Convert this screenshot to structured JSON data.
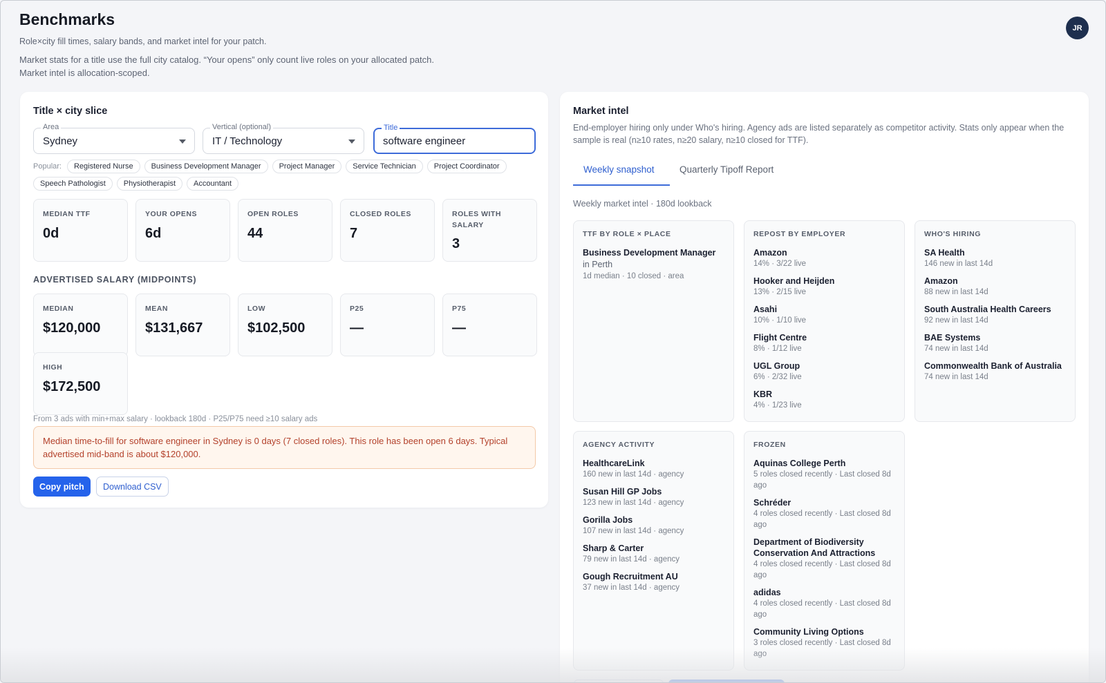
{
  "header": {
    "title": "Benchmarks",
    "subtitle": "Role×city fill times, salary bands, and market intel for your patch.",
    "description": "Market stats for a title use the full city catalog. “Your opens” only count live roles on your allocated patch. Market intel is allocation-scoped.",
    "avatar_initials": "JR"
  },
  "slice": {
    "title": "Title × city slice",
    "area": {
      "label": "Area",
      "value": "Sydney"
    },
    "vertical": {
      "label": "Vertical (optional)",
      "value": "IT / Technology"
    },
    "title_field": {
      "label": "Title",
      "value": "software engineer"
    },
    "popular_label": "Popular:",
    "popular": [
      "Registered Nurse",
      "Business Development Manager",
      "Project Manager",
      "Service Technician",
      "Project Coordinator",
      "Speech Pathologist",
      "Physiotherapist",
      "Accountant"
    ],
    "stats": [
      {
        "label": "MEDIAN TTF",
        "value": "0d"
      },
      {
        "label": "YOUR OPENS",
        "value": "6d"
      },
      {
        "label": "OPEN ROLES",
        "value": "44"
      },
      {
        "label": "CLOSED ROLES",
        "value": "7"
      },
      {
        "label": "ROLES WITH SALARY",
        "value": "3"
      }
    ],
    "salary_title": "ADVERTISED SALARY (MIDPOINTS)",
    "salary": [
      {
        "label": "MEDIAN",
        "value": "$120,000"
      },
      {
        "label": "MEAN",
        "value": "$131,667"
      },
      {
        "label": "LOW",
        "value": "$102,500"
      },
      {
        "label": "P25",
        "value": "—"
      },
      {
        "label": "P75",
        "value": "—"
      },
      {
        "label": "HIGH",
        "value": "$172,500"
      }
    ],
    "footnote": "From 3 ads with min+max salary · lookback 180d · P25/P75 need ≥10 salary ads",
    "pitch": "Median time-to-fill for software engineer in Sydney is 0 days (7 closed roles). This role has been open 6 days. Typical advertised mid-band is about $120,000.",
    "copy_label": "Copy pitch",
    "download_label": "Download CSV"
  },
  "intel": {
    "title": "Market intel",
    "description": "End-employer hiring only under Who's hiring. Agency ads are listed separately as competitor activity. Stats only appear when the sample is real (n≥10 rates, n≥20 salary, n≥10 closed for TTF).",
    "tabs": [
      "Weekly snapshot",
      "Quarterly Tipoff Report"
    ],
    "lookback": "Weekly market intel · 180d lookback",
    "ttf": {
      "title": "TTF BY ROLE × PLACE",
      "role": "Business Development Manager",
      "connector": "in",
      "place": "Perth",
      "sub": "1d median · 10 closed · area"
    },
    "repost": {
      "title": "REPOST BY EMPLOYER",
      "items": [
        {
          "name": "Amazon",
          "sub": "14% · 3/22 live"
        },
        {
          "name": "Hooker and Heijden",
          "sub": "13% · 2/15 live"
        },
        {
          "name": "Asahi",
          "sub": "10% · 1/10 live"
        },
        {
          "name": "Flight Centre",
          "sub": "8% · 1/12 live"
        },
        {
          "name": "UGL Group",
          "sub": "6% · 2/32 live"
        },
        {
          "name": "KBR",
          "sub": "4% · 1/23 live"
        }
      ]
    },
    "hiring": {
      "title": "WHO'S HIRING",
      "items": [
        {
          "name": "SA Health",
          "sub": "146 new in last 14d"
        },
        {
          "name": "Amazon",
          "sub": "88 new in last 14d"
        },
        {
          "name": "South Australia Health Careers",
          "sub": "92 new in last 14d"
        },
        {
          "name": "BAE Systems",
          "sub": "74 new in last 14d"
        },
        {
          "name": "Commonwealth Bank of Australia",
          "sub": "74 new in last 14d"
        }
      ]
    },
    "agency": {
      "title": "AGENCY ACTIVITY",
      "items": [
        {
          "name": "HealthcareLink",
          "sub": "160 new in last 14d · agency"
        },
        {
          "name": "Susan Hill GP Jobs",
          "sub": "123 new in last 14d · agency"
        },
        {
          "name": "Gorilla Jobs",
          "sub": "107 new in last 14d · agency"
        },
        {
          "name": "Sharp & Carter",
          "sub": "79 new in last 14d · agency"
        },
        {
          "name": "Gough Recruitment AU",
          "sub": "37 new in last 14d · agency"
        }
      ]
    },
    "frozen": {
      "title": "FROZEN",
      "items": [
        {
          "name": "Aquinas College Perth",
          "sub": "5 roles closed recently · Last closed 8d ago"
        },
        {
          "name": "Schréder",
          "sub": "4 roles closed recently · Last closed 8d ago"
        },
        {
          "name": "Department of Biodiversity Conservation And Attractions",
          "sub": "4 roles closed recently · Last closed 8d ago"
        },
        {
          "name": "adidas",
          "sub": "4 roles closed recently · Last closed 8d ago"
        },
        {
          "name": "Community Living Options",
          "sub": "3 roles closed recently · Last closed 8d ago"
        }
      ]
    }
  }
}
